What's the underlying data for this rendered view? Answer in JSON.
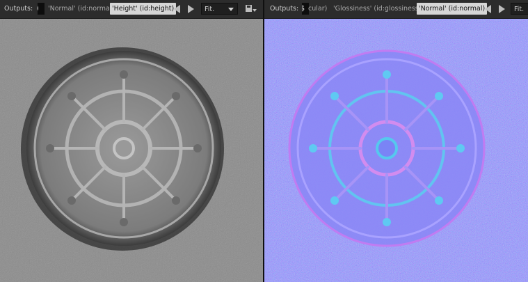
{
  "left_panel": {
    "outputs_label": "Outputs:",
    "scrub_value": ")",
    "tabs": [
      {
        "label": "'Normal' (id:normal)",
        "active": false
      },
      {
        "label": "'Height' (id:height)",
        "active": true
      }
    ],
    "fit": "Fit.",
    "icons": [
      "triangle-left-icon",
      "triangle-right-icon",
      "chevron-down-icon",
      "save-image-icon"
    ]
  },
  "right_panel": {
    "outputs_label": "Outputs:",
    "scrub_value": "$",
    "tabs": [
      {
        "label": "cular)",
        "active": false
      },
      {
        "label": "'Glossiness' (id:glossiness)",
        "active": false
      },
      {
        "label": "'Normal' (id:normal)",
        "active": true
      }
    ],
    "fit": "Fit.",
    "icons": [
      "triangle-left-icon",
      "triangle-right-icon"
    ]
  },
  "colors": {
    "height_map_base": "#8a8a8a",
    "normal_map_base": "#7f80fc",
    "active_tab": "#d6d6d6"
  }
}
